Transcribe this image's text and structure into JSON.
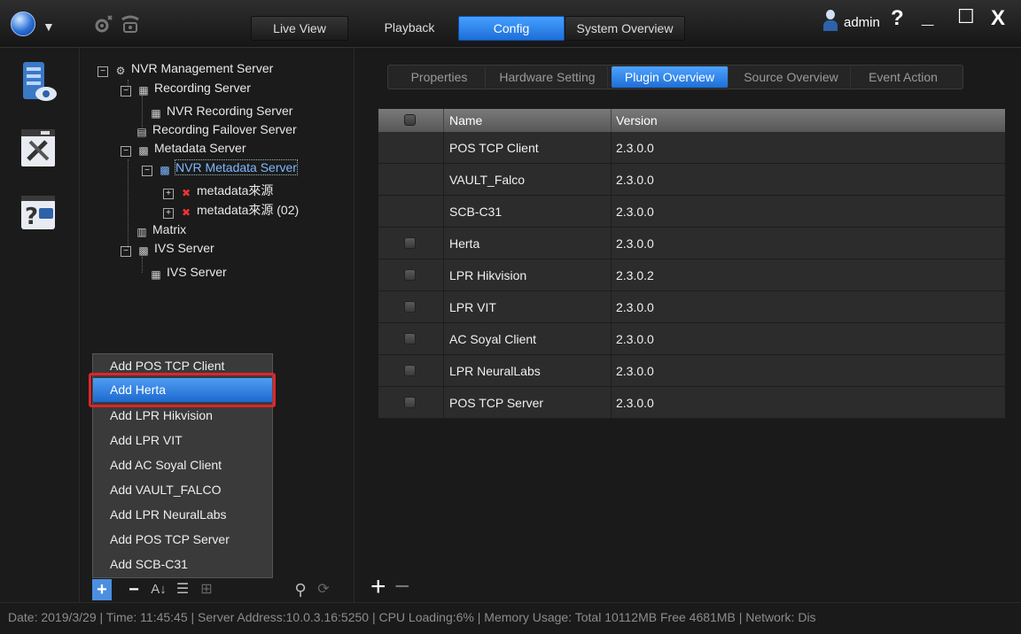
{
  "top_tabs": {
    "live_view": "Live View",
    "playback": "Playback",
    "config": "Config",
    "system_overview": "System Overview"
  },
  "user": {
    "name": "admin"
  },
  "window_buttons": {
    "help": "?",
    "minimize": "_",
    "maximize": "☐",
    "close": "X"
  },
  "tree": {
    "nvr_mgmt": "NVR Management Server",
    "recording_server": "Recording Server",
    "nvr_recording_server": "NVR Recording Server",
    "recording_failover": "Recording Failover Server",
    "metadata_server": "Metadata Server",
    "nvr_metadata_server": "NVR Metadata Server",
    "metadata_src1": "metadata來源",
    "metadata_src2": "metadata來源 (02)",
    "matrix": "Matrix",
    "ivs_server": "IVS Server",
    "ivs_server_child": "IVS Server"
  },
  "context_menu": {
    "items": [
      "Add POS TCP Client",
      "Add Herta",
      "Add LPR Hikvision",
      "Add LPR VIT",
      "Add AC Soyal Client",
      "Add VAULT_FALCO",
      "Add LPR NeuralLabs",
      "Add POS TCP Server",
      "Add SCB-C31"
    ],
    "highlighted": "Add Herta"
  },
  "sub_tabs": {
    "properties": "Properties",
    "hardware_setting": "Hardware Setting",
    "plugin_overview": "Plugin Overview",
    "source_overview": "Source Overview",
    "event_action": "Event Action"
  },
  "table": {
    "headers": {
      "name": "Name",
      "version": "Version"
    },
    "rows": [
      {
        "name": "POS TCP Client",
        "version": "2.3.0.0",
        "checkbox": false
      },
      {
        "name": "VAULT_Falco",
        "version": "2.3.0.0",
        "checkbox": false
      },
      {
        "name": "SCB-C31",
        "version": "2.3.0.0",
        "checkbox": false
      },
      {
        "name": "Herta",
        "version": "2.3.0.0",
        "checkbox": true
      },
      {
        "name": "LPR Hikvision",
        "version": "2.3.0.2",
        "checkbox": true
      },
      {
        "name": "LPR VIT",
        "version": "2.3.0.0",
        "checkbox": true
      },
      {
        "name": "AC Soyal Client",
        "version": "2.3.0.0",
        "checkbox": true
      },
      {
        "name": "LPR NeuralLabs",
        "version": "2.3.0.0",
        "checkbox": true
      },
      {
        "name": "POS TCP Server",
        "version": "2.3.0.0",
        "checkbox": true
      }
    ]
  },
  "status": {
    "text": "Date: 2019/3/29  |  Time: 11:45:45  |  Server Address:10.0.3.16:5250  |  CPU Loading:6%  |  Memory Usage: Total 10112MB  Free 4681MB  |  Network: Dis"
  },
  "colors": {
    "accent_blue": "#2f86ef",
    "highlight_border": "#e0242b",
    "background": "#1a1a1a"
  }
}
